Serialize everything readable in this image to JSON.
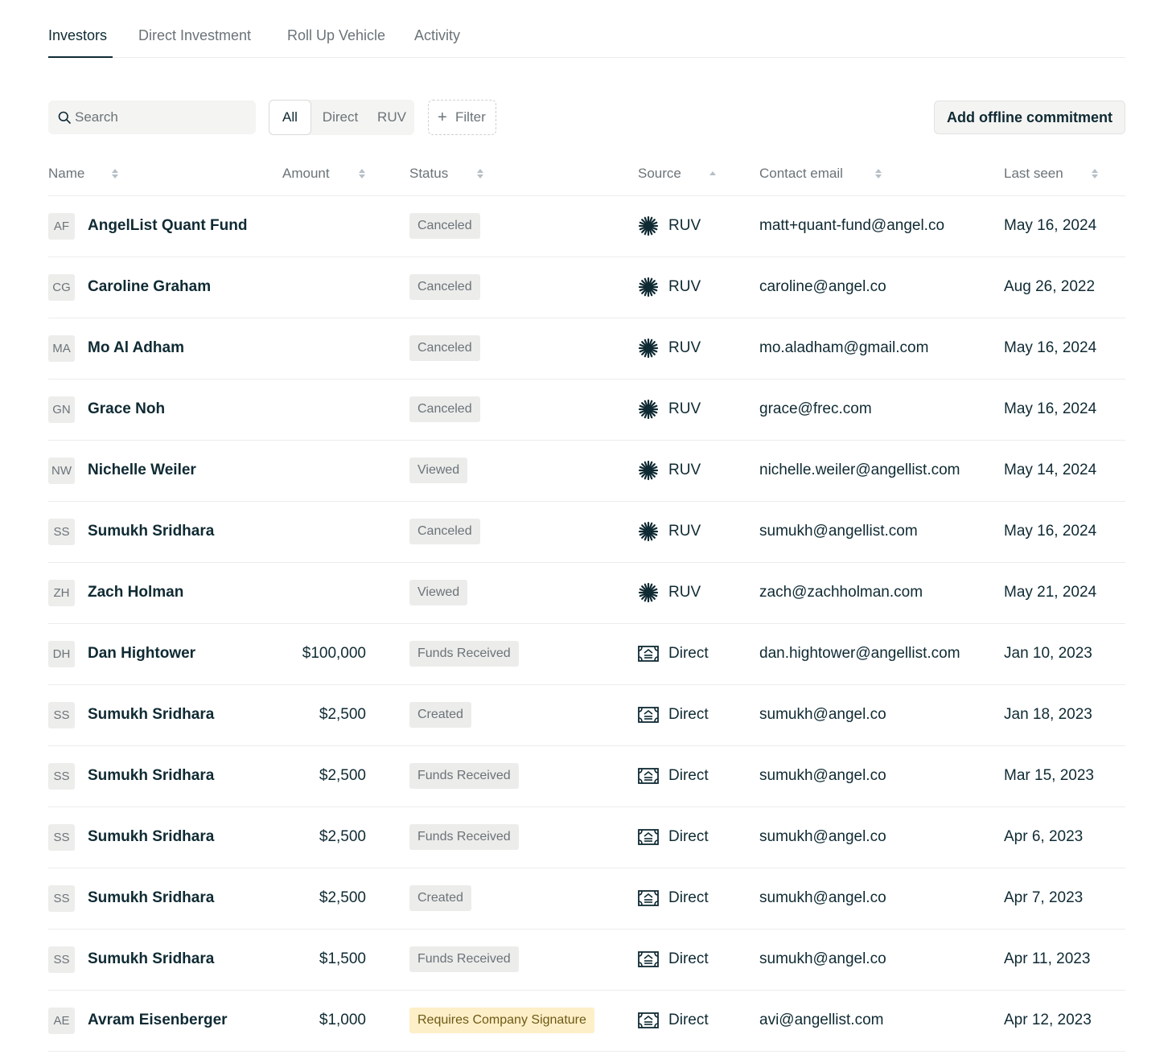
{
  "tabs": [
    "Investors",
    "Direct Investment",
    "Roll Up Vehicle",
    "Activity"
  ],
  "active_tab": "Investors",
  "search": {
    "placeholder": "Search"
  },
  "segments": [
    "All",
    "Direct",
    "RUV"
  ],
  "active_segment": "All",
  "filter_label": "Filter",
  "add_button_label": "Add offline commitment",
  "columns": [
    "Name",
    "Amount",
    "Status",
    "Source",
    "Contact email",
    "Last seen"
  ],
  "sorted_column": "Source",
  "sort_direction": "ascending",
  "colors": {
    "text": "#0f2a33",
    "muted": "#6b7378",
    "badge": "#ececeb",
    "warning_badge": "#fdefc8",
    "warning_text": "#6e5a14"
  },
  "rows": [
    {
      "initials": "AF",
      "name": "AngelList Quant Fund",
      "amount": "",
      "status": "Canceled",
      "source": "RUV",
      "source_icon": "sparkle-icon",
      "email": "matt+quant-fund@angel.co",
      "last_seen": "May 16, 2024"
    },
    {
      "initials": "CG",
      "name": "Caroline Graham",
      "amount": "",
      "status": "Canceled",
      "source": "RUV",
      "source_icon": "sparkle-icon",
      "email": "caroline@angel.co",
      "last_seen": "Aug 26, 2022"
    },
    {
      "initials": "MA",
      "name": "Mo Al Adham",
      "amount": "",
      "status": "Canceled",
      "source": "RUV",
      "source_icon": "sparkle-icon",
      "email": "mo.aladham@gmail.com",
      "last_seen": "May 16, 2024"
    },
    {
      "initials": "GN",
      "name": "Grace Noh",
      "amount": "",
      "status": "Canceled",
      "source": "RUV",
      "source_icon": "sparkle-icon",
      "email": "grace@frec.com",
      "last_seen": "May 16, 2024"
    },
    {
      "initials": "NW",
      "name": "Nichelle Weiler",
      "amount": "",
      "status": "Viewed",
      "source": "RUV",
      "source_icon": "sparkle-icon",
      "email": "nichelle.weiler@angellist.com",
      "last_seen": "May 14, 2024"
    },
    {
      "initials": "SS",
      "name": "Sumukh Sridhara",
      "amount": "",
      "status": "Canceled",
      "source": "RUV",
      "source_icon": "sparkle-icon",
      "email": "sumukh@angellist.com",
      "last_seen": "May 16, 2024"
    },
    {
      "initials": "ZH",
      "name": "Zach Holman",
      "amount": "",
      "status": "Viewed",
      "source": "RUV",
      "source_icon": "sparkle-icon",
      "email": "zach@zachholman.com",
      "last_seen": "May 21, 2024"
    },
    {
      "initials": "DH",
      "name": "Dan Hightower",
      "amount": "$100,000",
      "status": "Funds Received",
      "source": "Direct",
      "source_icon": "check-document-icon",
      "email": "dan.hightower@angellist.com",
      "last_seen": "Jan 10, 2023"
    },
    {
      "initials": "SS",
      "name": "Sumukh Sridhara",
      "amount": "$2,500",
      "status": "Created",
      "source": "Direct",
      "source_icon": "check-document-icon",
      "email": "sumukh@angel.co",
      "last_seen": "Jan 18, 2023"
    },
    {
      "initials": "SS",
      "name": "Sumukh Sridhara",
      "amount": "$2,500",
      "status": "Funds Received",
      "source": "Direct",
      "source_icon": "check-document-icon",
      "email": "sumukh@angel.co",
      "last_seen": "Mar 15, 2023"
    },
    {
      "initials": "SS",
      "name": "Sumukh Sridhara",
      "amount": "$2,500",
      "status": "Funds Received",
      "source": "Direct",
      "source_icon": "check-document-icon",
      "email": "sumukh@angel.co",
      "last_seen": "Apr 6, 2023"
    },
    {
      "initials": "SS",
      "name": "Sumukh Sridhara",
      "amount": "$2,500",
      "status": "Created",
      "source": "Direct",
      "source_icon": "check-document-icon",
      "email": "sumukh@angel.co",
      "last_seen": "Apr 7, 2023"
    },
    {
      "initials": "SS",
      "name": "Sumukh Sridhara",
      "amount": "$1,500",
      "status": "Funds Received",
      "source": "Direct",
      "source_icon": "check-document-icon",
      "email": "sumukh@angel.co",
      "last_seen": "Apr 11, 2023"
    },
    {
      "initials": "AE",
      "name": "Avram Eisenberger",
      "amount": "$1,000",
      "status": "Requires Company Signature",
      "status_variant": "warning",
      "source": "Direct",
      "source_icon": "check-document-icon",
      "email": "avi@angellist.com",
      "last_seen": "Apr 12, 2023"
    }
  ]
}
